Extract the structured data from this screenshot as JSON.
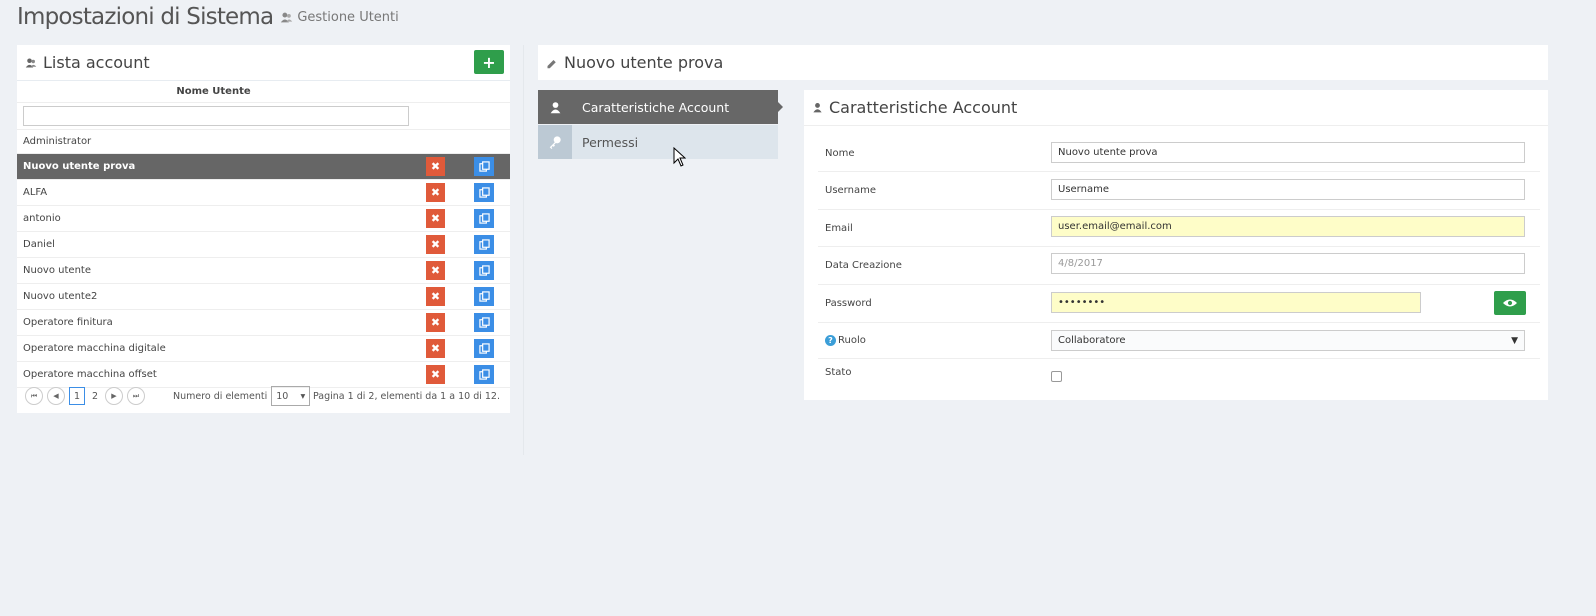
{
  "header": {
    "title": "Impostazioni di Sistema",
    "subtitle": "Gestione Utenti"
  },
  "account_list": {
    "title": "Lista account",
    "add_label": "+",
    "column_header": "Nome Utente",
    "filter_value": "",
    "rows": [
      {
        "name": "Administrator",
        "selected": false,
        "actions": false
      },
      {
        "name": "Nuovo utente prova",
        "selected": true,
        "actions": true
      },
      {
        "name": "ALFA",
        "selected": false,
        "actions": true
      },
      {
        "name": "antonio",
        "selected": false,
        "actions": true
      },
      {
        "name": "Daniel",
        "selected": false,
        "actions": true
      },
      {
        "name": "Nuovo utente",
        "selected": false,
        "actions": true
      },
      {
        "name": "Nuovo utente2",
        "selected": false,
        "actions": true
      },
      {
        "name": "Operatore finitura",
        "selected": false,
        "actions": true
      },
      {
        "name": "Operatore macchina digitale",
        "selected": false,
        "actions": true
      },
      {
        "name": "Operatore macchina offset",
        "selected": false,
        "actions": true
      }
    ],
    "delete_glyph": "✖",
    "pager": {
      "first": "⏮",
      "prev": "◀",
      "pages": [
        "1",
        "2"
      ],
      "current_page": "1",
      "next": "▶",
      "last": "⏭",
      "page_size_label": "Numero di elementi",
      "page_size": "10",
      "info": "Pagina 1 di 2, elementi da 1 a 10 di 12."
    }
  },
  "detail": {
    "title": "Nuovo utente prova",
    "tabs": [
      {
        "label": "Caratteristiche Account",
        "active": true
      },
      {
        "label": "Permessi",
        "active": false
      }
    ],
    "form": {
      "title": "Caratteristiche Account",
      "nome_label": "Nome",
      "nome_value": "Nuovo utente prova",
      "username_label": "Username",
      "username_value": "Username",
      "email_label": "Email",
      "email_value": "user.email@email.com",
      "data_label": "Data Creazione",
      "data_value": "4/8/2017",
      "password_label": "Password",
      "password_value": "••••••••",
      "ruolo_label": "Ruolo",
      "ruolo_help": "?",
      "ruolo_value": "Collaboratore",
      "stato_label": "Stato",
      "stato_checked": false
    }
  },
  "colors": {
    "accent_green": "#2f9e4b",
    "delete_red": "#e05a3a",
    "copy_blue": "#3b8ee6",
    "selected_row": "#666666",
    "autofill_yellow": "#fefdc8"
  },
  "icons": {
    "subtitle": "users-icon",
    "list": "users-icon",
    "detail": "edit-icon",
    "tab_account": "user-icon",
    "tab_permissions": "key-icon",
    "form": "user-icon",
    "delete": "close-icon",
    "copy": "copy-icon",
    "password_toggle": "eye-icon",
    "help": "help-icon"
  }
}
